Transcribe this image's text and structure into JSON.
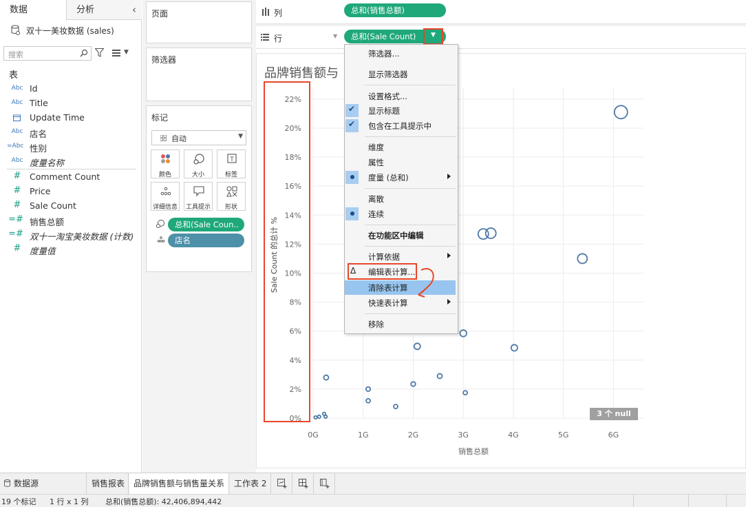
{
  "left_pane": {
    "tabs": [
      "数据",
      "分析"
    ],
    "datasource": "双十一美妆数据 (sales)",
    "search_placeholder": "搜索",
    "table_header": "表",
    "dimensions": [
      {
        "type": "Abc",
        "name": "Id"
      },
      {
        "type": "Abc",
        "name": "Title"
      },
      {
        "type": "calendar",
        "name": "Update Time"
      },
      {
        "type": "Abc",
        "name": "店名"
      },
      {
        "type": "=Abc",
        "name": "性别"
      },
      {
        "type": "Abc",
        "name": "度量名称"
      }
    ],
    "measures": [
      {
        "type": "#",
        "name": "Comment Count"
      },
      {
        "type": "#",
        "name": "Price"
      },
      {
        "type": "#",
        "name": "Sale Count"
      },
      {
        "type": "=#",
        "name": "销售总额"
      },
      {
        "type": "=#",
        "name": "双十一淘宝美妆数据 (计数)"
      },
      {
        "type": "#",
        "name": "度量值"
      }
    ]
  },
  "shelves": {
    "pages": "页面",
    "filters": "筛选器",
    "marks": "标记",
    "mark_type": "自动",
    "mark_buttons": [
      "颜色",
      "大小",
      "标签",
      "详细信息",
      "工具提示",
      "形状"
    ],
    "marks_pills": [
      "总和(Sale Coun..",
      "店名"
    ],
    "columns_label": "列",
    "rows_label": "行",
    "columns_pill": "总和(销售总额)",
    "rows_pill": "总和(Sale Count)"
  },
  "context_menu": {
    "items": [
      {
        "label": "筛选器...",
        "mark": "",
        "submenu": false
      },
      {
        "label": "显示筛选器",
        "mark": "",
        "submenu": false
      },
      {
        "label": "设置格式...",
        "mark": "",
        "submenu": false
      },
      {
        "label": "显示标题",
        "mark": "check",
        "submenu": false
      },
      {
        "label": "包含在工具提示中",
        "mark": "check",
        "submenu": false
      },
      {
        "label": "维度",
        "mark": "",
        "submenu": false
      },
      {
        "label": "属性",
        "mark": "",
        "submenu": false
      },
      {
        "label": "度量 (总和)",
        "mark": "dot",
        "submenu": true
      },
      {
        "label": "离散",
        "mark": "",
        "submenu": false
      },
      {
        "label": "连续",
        "mark": "dot",
        "submenu": false
      },
      {
        "label": "在功能区中编辑",
        "mark": "",
        "submenu": false
      },
      {
        "label": "计算依据",
        "mark": "",
        "submenu": true
      },
      {
        "label": "编辑表计算...",
        "mark": "delta",
        "submenu": false
      },
      {
        "label": "清除表计算",
        "mark": "",
        "submenu": false
      },
      {
        "label": "快速表计算",
        "mark": "",
        "submenu": true
      },
      {
        "label": "移除",
        "mark": "",
        "submenu": false
      }
    ],
    "highlighted": "清除表计算"
  },
  "chart_data": {
    "type": "scatter",
    "title": "品牌销售额与",
    "xlabel": "销售总额",
    "ylabel": "Sale Count 的总计 %",
    "x_ticks": [
      "0G",
      "1G",
      "2G",
      "3G",
      "4G",
      "5G",
      "6G"
    ],
    "y_ticks": [
      "0%",
      "2%",
      "4%",
      "6%",
      "8%",
      "10%",
      "12%",
      "14%",
      "16%",
      "18%",
      "20%",
      "22%"
    ],
    "xlim": [
      0,
      6.6
    ],
    "ylim": [
      0,
      22.8
    ],
    "x_unit": "G",
    "y_unit": "%",
    "marker": "hollow-circle",
    "color": "#4e79a7",
    "points": [
      {
        "x": 0.05,
        "y": 0.05,
        "s": 2.2
      },
      {
        "x": 0.12,
        "y": 0.1,
        "s": 2.2
      },
      {
        "x": 0.22,
        "y": 0.3,
        "s": 2.2
      },
      {
        "x": 0.25,
        "y": 0.1,
        "s": 2.2
      },
      {
        "x": 0.26,
        "y": 2.8,
        "s": 3.5
      },
      {
        "x": 1.1,
        "y": 2.0,
        "s": 3.2
      },
      {
        "x": 1.1,
        "y": 1.2,
        "s": 3.0
      },
      {
        "x": 1.65,
        "y": 0.8,
        "s": 3.0
      },
      {
        "x": 2.0,
        "y": 2.35,
        "s": 3.3
      },
      {
        "x": 2.08,
        "y": 4.95,
        "s": 4.5
      },
      {
        "x": 2.53,
        "y": 2.9,
        "s": 3.5
      },
      {
        "x": 3.0,
        "y": 5.85,
        "s": 4.8
      },
      {
        "x": 3.04,
        "y": 1.75,
        "s": 3.0
      },
      {
        "x": 3.4,
        "y": 12.7,
        "s": 7.5
      },
      {
        "x": 3.55,
        "y": 12.75,
        "s": 7.5
      },
      {
        "x": 4.02,
        "y": 4.85,
        "s": 4.6
      },
      {
        "x": 5.38,
        "y": 11.0,
        "s": 7.0
      },
      {
        "x": 6.15,
        "y": 21.1,
        "s": 9.5
      }
    ],
    "null_badge": "3 个 null"
  },
  "sheet_tabs": [
    "数据源",
    "销售报表",
    "品牌销售额与销售量关系",
    "工作表 2"
  ],
  "status_bar": {
    "marks": "19 个标记",
    "rows": "1 行 x 1 列",
    "sum": "总和(销售总额): 42,406,894,442"
  }
}
